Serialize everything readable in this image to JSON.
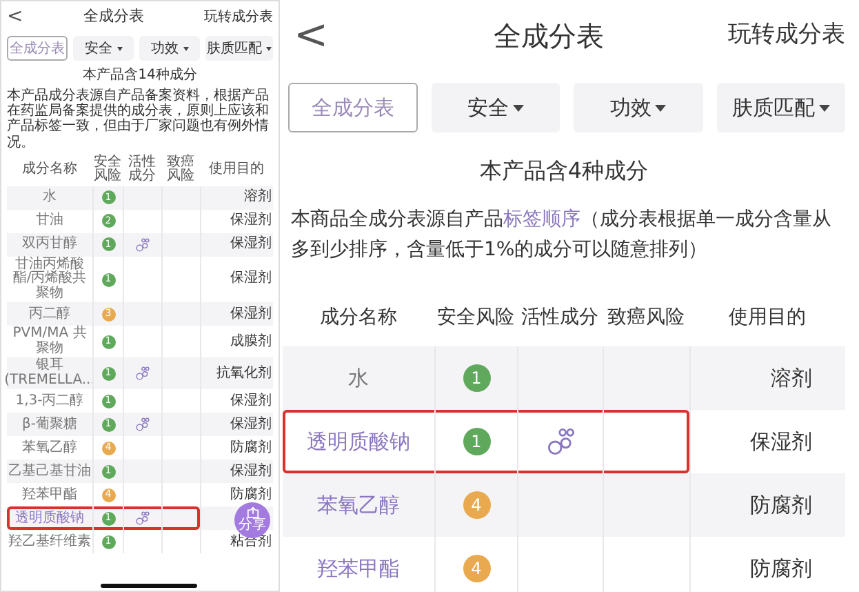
{
  "panels": [
    {
      "header": {
        "back": "<",
        "title": "全成分表",
        "action": "玩转成分表"
      },
      "tabs": [
        {
          "label": "全成分表",
          "selected": true,
          "dropdown": false
        },
        {
          "label": "安全",
          "selected": false,
          "dropdown": true
        },
        {
          "label": "功效",
          "selected": false,
          "dropdown": true
        },
        {
          "label": "肤质匹配",
          "selected": false,
          "dropdown": true
        }
      ],
      "count_text": "本产品含14种成分",
      "description": {
        "before": "本产品成分表源自产品备案资料，根据产品在药监局备案提供的成分表，原则上应该和产品标签一致，但由于厂家问题也有例外情况。"
      },
      "columns": [
        "成分名称",
        "安全风险",
        "活性成分",
        "致癌风险",
        "使用目的"
      ],
      "rows": [
        {
          "name": "水",
          "safety": "1",
          "color": "#5fa85c",
          "active": false,
          "use": "溶剂",
          "linked": false,
          "highlighted": false
        },
        {
          "name": "甘油",
          "safety": "2",
          "color": "#5fa85c",
          "active": false,
          "use": "保湿剂",
          "linked": false,
          "highlighted": false
        },
        {
          "name": "双丙甘醇",
          "safety": "1",
          "color": "#5fa85c",
          "active": true,
          "use": "保湿剂",
          "linked": false,
          "highlighted": false
        },
        {
          "name": "甘油丙烯酸酯/丙烯酸共聚物",
          "safety": "1",
          "color": "#5fa85c",
          "active": false,
          "use": "保湿剂",
          "linked": false,
          "highlighted": false
        },
        {
          "name": "丙二醇",
          "safety": "3",
          "color": "#e9a94f",
          "active": false,
          "use": "保湿剂",
          "linked": false,
          "highlighted": false
        },
        {
          "name": "PVM/MA 共聚物",
          "safety": "1",
          "color": "#5fa85c",
          "active": false,
          "use": "成膜剂",
          "linked": false,
          "highlighted": false
        },
        {
          "name": "银耳 (TREMELLA...",
          "safety": "1",
          "color": "#5fa85c",
          "active": true,
          "use": "抗氧化剂",
          "linked": false,
          "highlighted": false
        },
        {
          "name": "1,3-丙二醇",
          "safety": "1",
          "color": "#5fa85c",
          "active": false,
          "use": "保湿剂",
          "linked": false,
          "highlighted": false
        },
        {
          "name": "β-葡聚糖",
          "safety": "1",
          "color": "#5fa85c",
          "active": true,
          "use": "保湿剂",
          "linked": false,
          "highlighted": false
        },
        {
          "name": "苯氧乙醇",
          "safety": "4",
          "color": "#e9a94f",
          "active": false,
          "use": "防腐剂",
          "linked": false,
          "highlighted": false
        },
        {
          "name": "乙基己基甘油",
          "safety": "1",
          "color": "#5fa85c",
          "active": false,
          "use": "保湿剂",
          "linked": false,
          "highlighted": false
        },
        {
          "name": "羟苯甲酯",
          "safety": "4",
          "color": "#e9a94f",
          "active": false,
          "use": "防腐剂",
          "linked": false,
          "highlighted": false
        },
        {
          "name": "透明质酸钠",
          "safety": "1",
          "color": "#5fa85c",
          "active": true,
          "linked": true,
          "highlighted": true
        },
        {
          "name": "羟乙基纤维素",
          "safety": "1",
          "color": "#5fa85c",
          "active": false,
          "use": "粘合剂",
          "linked": false,
          "highlighted": false
        }
      ],
      "share_button": {
        "label": "分享"
      },
      "home_indicator": true
    },
    {
      "header": {
        "back": "<",
        "title": "全成分表",
        "action": "玩转成分表"
      },
      "tabs": [
        {
          "label": "全成分表",
          "selected": true,
          "dropdown": false
        },
        {
          "label": "安全",
          "selected": false,
          "dropdown": true
        },
        {
          "label": "功效",
          "selected": false,
          "dropdown": true
        },
        {
          "label": "肤质匹配",
          "selected": false,
          "dropdown": true
        }
      ],
      "count_text": "本产品含4种成分",
      "description": {
        "before": "本商品全成分表源自产品",
        "link": "标签顺序",
        "after": "（成分表根据单一成分含量从多到少排序，含量低于1%的成分可以随意排列）"
      },
      "columns": [
        "成分名称",
        "安全风险",
        "活性成分",
        "致癌风险",
        "使用目的"
      ],
      "rows": [
        {
          "name": "水",
          "safety": "1",
          "color": "#5fa85c",
          "active": false,
          "use": "溶剂",
          "linked": false,
          "highlighted": false
        },
        {
          "name": "透明质酸钠",
          "safety": "1",
          "color": "#5fa85c",
          "active": true,
          "use": "保湿剂",
          "linked": true,
          "highlighted": true
        },
        {
          "name": "苯氧乙醇",
          "safety": "4",
          "color": "#e9a94f",
          "active": false,
          "use": "防腐剂",
          "linked": true,
          "highlighted": false
        },
        {
          "name": "羟苯甲酯",
          "safety": "4",
          "color": "#e9a94f",
          "active": false,
          "use": "防腐剂",
          "linked": true,
          "highlighted": false
        }
      ]
    }
  ]
}
